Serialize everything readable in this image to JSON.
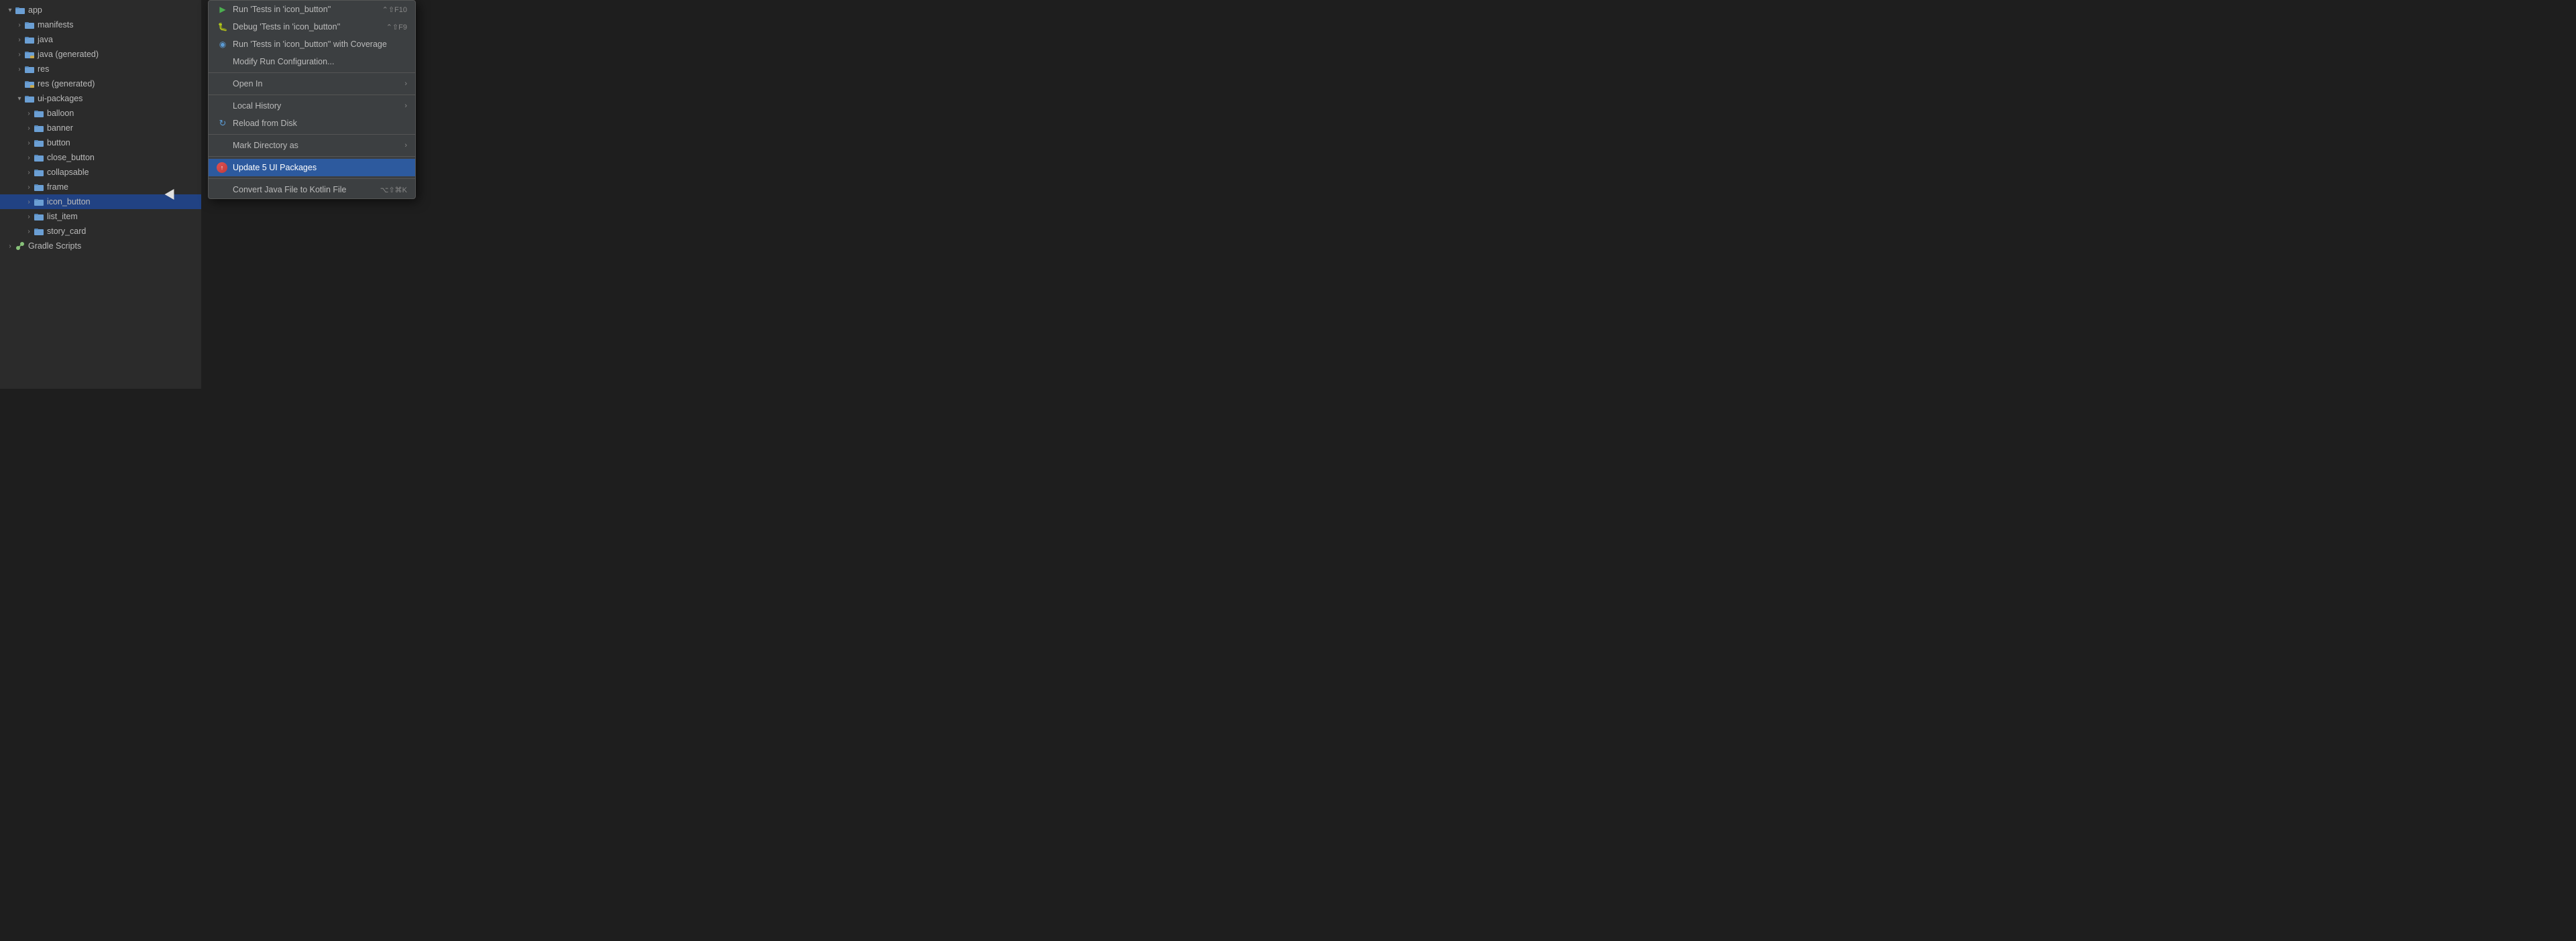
{
  "fileTree": {
    "items": [
      {
        "id": "app",
        "label": "app",
        "indent": 1,
        "type": "folder-open",
        "hasChevron": true,
        "chevronOpen": true,
        "selected": false
      },
      {
        "id": "manifests",
        "label": "manifests",
        "indent": 2,
        "type": "folder",
        "hasChevron": true,
        "chevronOpen": false,
        "selected": false
      },
      {
        "id": "java",
        "label": "java",
        "indent": 2,
        "type": "folder",
        "hasChevron": true,
        "chevronOpen": false,
        "selected": false
      },
      {
        "id": "java-generated",
        "label": "java (generated)",
        "indent": 2,
        "type": "folder-special",
        "hasChevron": true,
        "chevronOpen": false,
        "selected": false
      },
      {
        "id": "res",
        "label": "res",
        "indent": 2,
        "type": "folder",
        "hasChevron": true,
        "chevronOpen": false,
        "selected": false
      },
      {
        "id": "res-generated",
        "label": "res (generated)",
        "indent": 2,
        "type": "folder-special",
        "hasChevron": false,
        "chevronOpen": false,
        "selected": false
      },
      {
        "id": "ui-packages",
        "label": "ui-packages",
        "indent": 2,
        "type": "folder-open",
        "hasChevron": true,
        "chevronOpen": true,
        "selected": false
      },
      {
        "id": "balloon",
        "label": "balloon",
        "indent": 3,
        "type": "folder",
        "hasChevron": true,
        "chevronOpen": false,
        "selected": false
      },
      {
        "id": "banner",
        "label": "banner",
        "indent": 3,
        "type": "folder",
        "hasChevron": true,
        "chevronOpen": false,
        "selected": false
      },
      {
        "id": "button",
        "label": "button",
        "indent": 3,
        "type": "folder",
        "hasChevron": true,
        "chevronOpen": false,
        "selected": false
      },
      {
        "id": "close_button",
        "label": "close_button",
        "indent": 3,
        "type": "folder",
        "hasChevron": true,
        "chevronOpen": false,
        "selected": false
      },
      {
        "id": "collapsable",
        "label": "collapsable",
        "indent": 3,
        "type": "folder",
        "hasChevron": true,
        "chevronOpen": false,
        "selected": false
      },
      {
        "id": "frame",
        "label": "frame",
        "indent": 3,
        "type": "folder",
        "hasChevron": true,
        "chevronOpen": false,
        "selected": false
      },
      {
        "id": "icon_button",
        "label": "icon_button",
        "indent": 3,
        "type": "folder",
        "hasChevron": true,
        "chevronOpen": false,
        "selected": true,
        "highlighted": true
      },
      {
        "id": "list_item",
        "label": "list_item",
        "indent": 3,
        "type": "folder",
        "hasChevron": true,
        "chevronOpen": false,
        "selected": false
      },
      {
        "id": "story_card",
        "label": "story_card",
        "indent": 3,
        "type": "folder",
        "hasChevron": true,
        "chevronOpen": false,
        "selected": false
      },
      {
        "id": "gradle-scripts",
        "label": "Gradle Scripts",
        "indent": 1,
        "type": "gradle",
        "hasChevron": true,
        "chevronOpen": false,
        "selected": false
      }
    ]
  },
  "contextMenu": {
    "items": [
      {
        "id": "run-tests",
        "type": "run",
        "label": "Run 'Tests in 'icon_button''",
        "shortcut": "⌃⇧F10",
        "icon": "run"
      },
      {
        "id": "debug-tests",
        "type": "debug",
        "label": "Debug 'Tests in 'icon_button''",
        "shortcut": "⌃⇧F9",
        "icon": "debug"
      },
      {
        "id": "run-coverage",
        "type": "coverage",
        "label": "Run 'Tests in 'icon_button'' with Coverage",
        "shortcut": "",
        "icon": "coverage"
      },
      {
        "id": "modify-run",
        "type": "normal",
        "label": "Modify Run Configuration...",
        "shortcut": "",
        "icon": ""
      },
      {
        "id": "sep1",
        "type": "separator"
      },
      {
        "id": "open-in",
        "type": "submenu",
        "label": "Open In",
        "shortcut": "",
        "icon": "",
        "hasArrow": true
      },
      {
        "id": "sep2",
        "type": "separator"
      },
      {
        "id": "local-history",
        "type": "submenu",
        "label": "Local History",
        "shortcut": "",
        "icon": "",
        "hasArrow": true
      },
      {
        "id": "reload-disk",
        "type": "reload",
        "label": "Reload from Disk",
        "shortcut": "",
        "icon": "reload"
      },
      {
        "id": "sep3",
        "type": "separator"
      },
      {
        "id": "mark-directory",
        "type": "submenu",
        "label": "Mark Directory as",
        "shortcut": "",
        "icon": "",
        "hasArrow": true
      },
      {
        "id": "sep4",
        "type": "separator"
      },
      {
        "id": "update-packages",
        "type": "update",
        "label": "Update 5 UI Packages",
        "shortcut": "",
        "icon": "update",
        "active": true
      },
      {
        "id": "sep5",
        "type": "separator"
      },
      {
        "id": "convert-java",
        "type": "normal",
        "label": "Convert Java File to Kotlin File",
        "shortcut": "⌥⇧⌘K",
        "icon": ""
      }
    ]
  }
}
